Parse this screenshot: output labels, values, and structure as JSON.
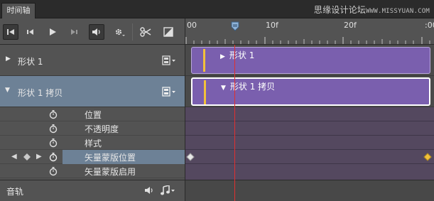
{
  "panel": {
    "tab_title": "时间轴"
  },
  "watermark": {
    "text": "思缘设计论坛",
    "sub": "WWW.MISSYUAN.COM"
  },
  "toolbar": {
    "buttons": [
      "go-to-first-frame",
      "go-to-previous-frame",
      "play",
      "go-to-next-frame",
      "audio",
      "settings",
      "split-at-playhead",
      "transition"
    ]
  },
  "ruler": {
    "labels": [
      "00",
      "10f",
      "20f",
      ":00"
    ]
  },
  "layers": [
    {
      "name": "形状 1",
      "expanded": false,
      "selected": false
    },
    {
      "name": "形状 1 拷贝",
      "expanded": true,
      "selected": true
    }
  ],
  "properties": [
    {
      "name": "位置",
      "selected": false
    },
    {
      "name": "不透明度",
      "selected": false
    },
    {
      "name": "样式",
      "selected": false
    },
    {
      "name": "矢量蒙版位置",
      "selected": true
    },
    {
      "name": "矢量蒙版启用",
      "selected": false
    }
  ],
  "audio_track": {
    "label": "音轨"
  },
  "clips": [
    {
      "label": "形状 1"
    },
    {
      "label": "形状 1 拷贝"
    }
  ],
  "colors": {
    "clip_fill": "#7a5fae",
    "selected_row": "#6d8196",
    "playhead": "#e0302f",
    "keyframe_start": "#e8e8e8",
    "keyframe_end": "#f2c13b"
  }
}
